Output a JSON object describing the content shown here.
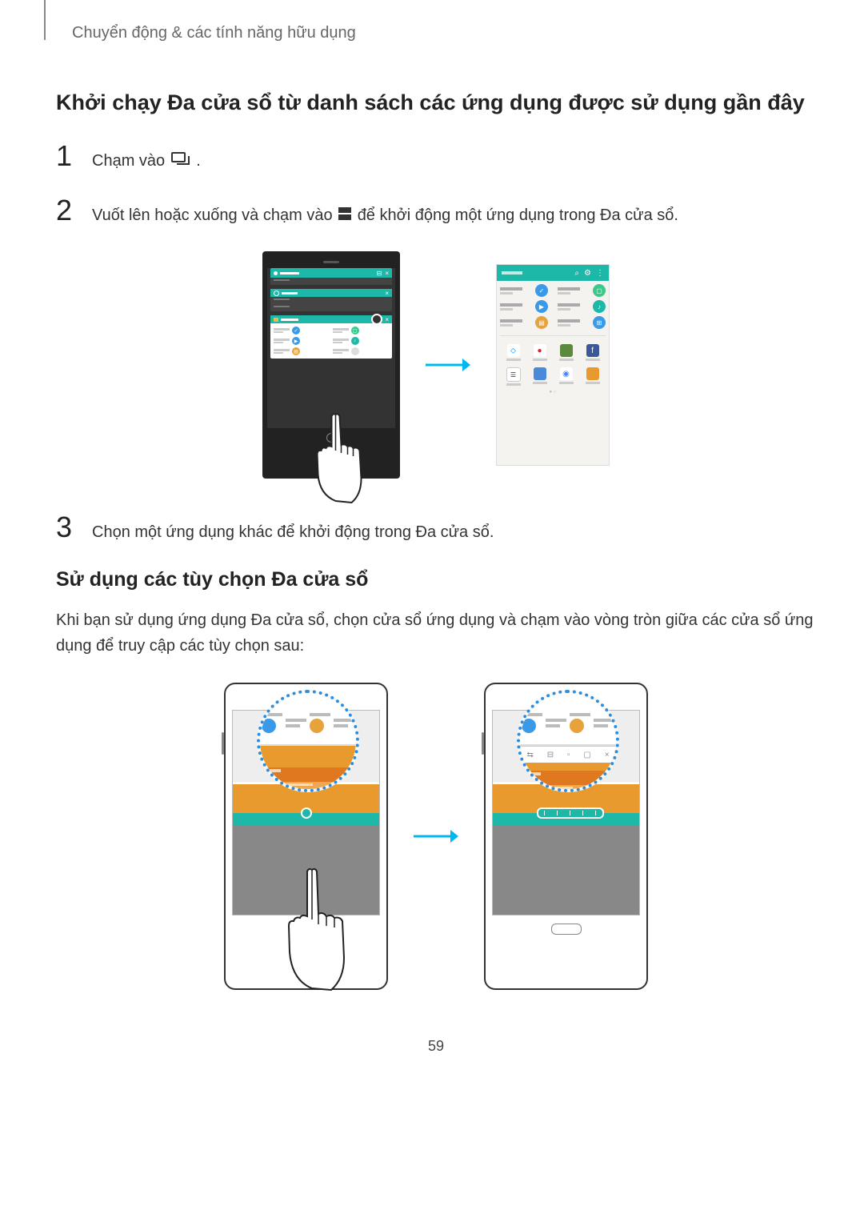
{
  "breadcrumb": "Chuyển động & các tính năng hữu dụng",
  "heading1": "Khởi chạy Đa cửa sổ từ danh sách các ứng dụng được sử dụng gần đây",
  "steps": {
    "s1num": "1",
    "s1": "Chạm vào ",
    "s1end": ".",
    "s2num": "2",
    "s2a": "Vuốt lên hoặc xuống và chạm vào ",
    "s2b": " để khởi động một ứng dụng trong Đa cửa sổ.",
    "s3num": "3",
    "s3": "Chọn một ứng dụng khác để khởi động trong Đa cửa sổ."
  },
  "heading2": "Sử dụng các tùy chọn Đa cửa sổ",
  "body1": "Khi bạn sử dụng ứng dụng Đa cửa sổ, chọn cửa sổ ứng dụng và chạm vào vòng tròn giữa các cửa sổ ứng dụng để truy cập các tùy chọn sau:",
  "page": "59"
}
